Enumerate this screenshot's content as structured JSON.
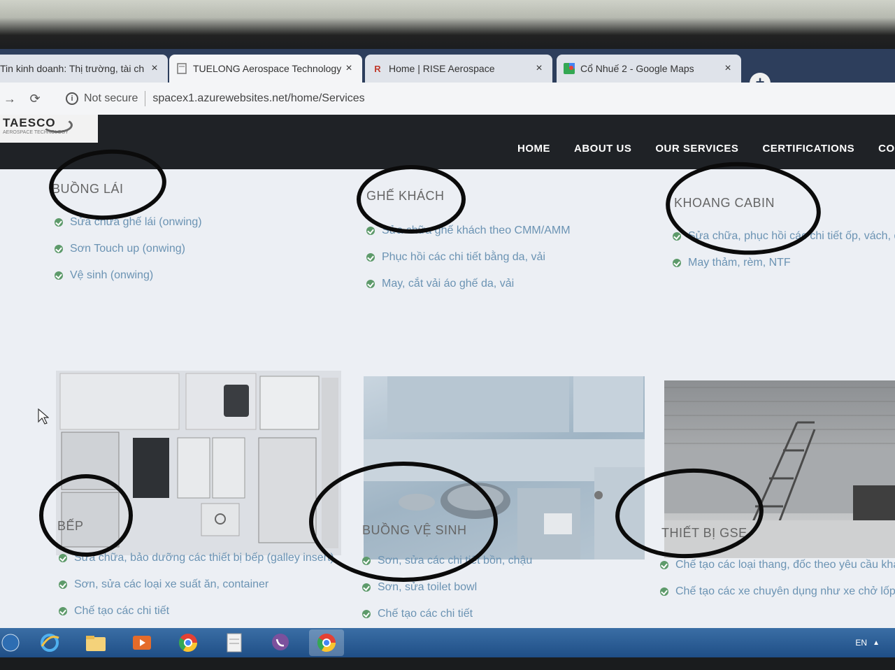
{
  "browser": {
    "tabs": [
      {
        "title": "Tin kinh doanh: Thị trường, tài ch",
        "icon": ""
      },
      {
        "title": "TUELONG Aerospace Technology",
        "icon": "page-icon"
      },
      {
        "title": "Home | RISE Aerospace",
        "icon": "R"
      },
      {
        "title": "Cổ Nhuế 2 - Google Maps",
        "icon": "maps-icon"
      }
    ],
    "close_glyph": "×",
    "new_tab_glyph": "+",
    "security_label": "Not secure",
    "url": "spacex1.azurewebsites.net/home/Services"
  },
  "site": {
    "logo_text": "TAESCO",
    "logo_subtitle": "AEROSPACE TECHNOLOGY",
    "nav": [
      "HOME",
      "ABOUT US",
      "OUR SERVICES",
      "CERTIFICATIONS",
      "CONT"
    ]
  },
  "services": [
    {
      "title": "BUỒNG LÁI",
      "items": [
        "Sửa chữa ghế lái (onwing)",
        "Sơn Touch up (onwing)",
        "Vệ sinh (onwing)"
      ]
    },
    {
      "title": "GHẾ KHÁCH",
      "items": [
        "Sửa chữa ghế khách theo CMM/AMM",
        "Phục hồi các chi tiết bằng da, vải",
        "May, cắt vải áo ghế da, vải"
      ]
    },
    {
      "title": "KHOANG CABIN",
      "items": [
        "Sửa chữa, phục hồi các chi tiết ốp, vách, d",
        "May thảm, rèm, NTF"
      ]
    },
    {
      "title": "BẾP",
      "items": [
        "Sửa chữa, bảo dưỡng các thiết bị bếp (galley insert)",
        "Sơn, sửa các loại xe suất ăn, container",
        "Chế tạo các chi tiết"
      ]
    },
    {
      "title": "BUỒNG VỆ SINH",
      "items": [
        "Sơn, sửa các chi tiết bồn, chậu",
        "Sơn, sửa toilet bowl",
        "Chế tạo các chi tiết"
      ]
    },
    {
      "title": "THIẾT BỊ GSE",
      "items": [
        "Chế tạo các loại thang, đốc theo yêu cầu khách",
        "Chế tạo các xe chuyên dụng như xe chở lốp, N"
      ]
    }
  ],
  "taskbar": {
    "language": "EN",
    "tray_arrow": "▲"
  }
}
